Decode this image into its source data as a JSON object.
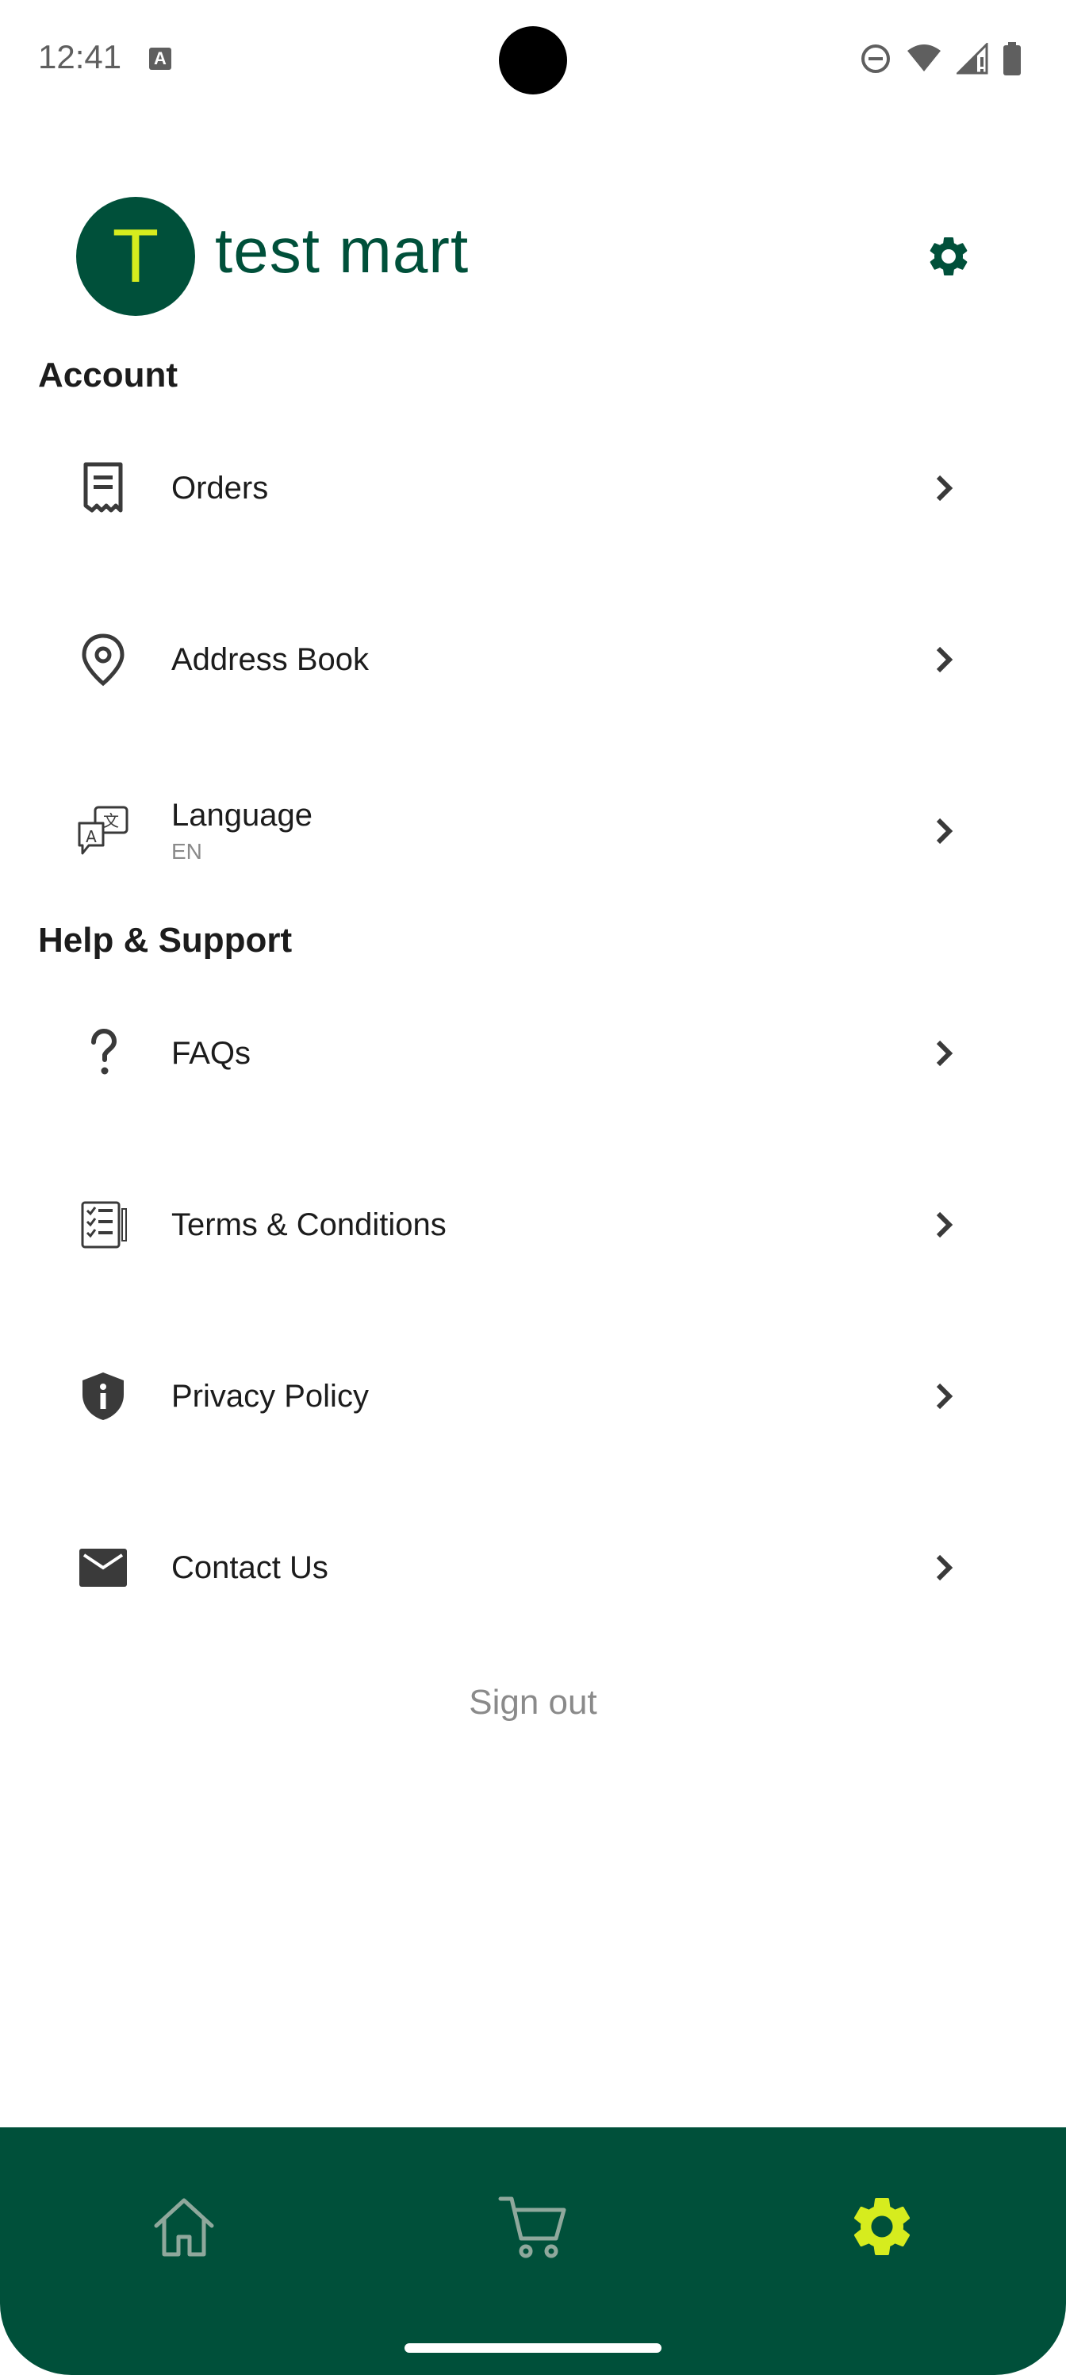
{
  "status_bar": {
    "time": "12:41",
    "app_icon_letter": "A",
    "icons": [
      "do-not-disturb-icon",
      "wifi-icon",
      "signal-icon",
      "battery-icon"
    ]
  },
  "header": {
    "avatar_letter": "T",
    "store_name": "test mart",
    "settings_icon": "gear-icon"
  },
  "sections": {
    "account": {
      "title": "Account",
      "items": [
        {
          "label": "Orders",
          "icon": "receipt-icon"
        },
        {
          "label": "Address Book",
          "icon": "location-pin-icon"
        },
        {
          "label": "Language",
          "sublabel": "EN",
          "icon": "translate-icon"
        }
      ]
    },
    "help": {
      "title": "Help & Support",
      "items": [
        {
          "label": "FAQs",
          "icon": "question-mark-icon"
        },
        {
          "label": "Terms & Conditions",
          "icon": "document-checklist-icon"
        },
        {
          "label": "Privacy Policy",
          "icon": "shield-info-icon"
        },
        {
          "label": "Contact Us",
          "icon": "envelope-icon"
        }
      ]
    }
  },
  "sign_out": "Sign out",
  "bottom_nav": {
    "items": [
      {
        "name": "home",
        "icon": "home-icon",
        "active": false
      },
      {
        "name": "cart",
        "icon": "cart-icon",
        "active": false
      },
      {
        "name": "settings",
        "icon": "gear-icon",
        "active": true
      }
    ]
  },
  "colors": {
    "brand_green": "#00503a",
    "accent_lime": "#d6ec1e",
    "text": "#1c1c1c",
    "muted": "#8a8a8a"
  }
}
